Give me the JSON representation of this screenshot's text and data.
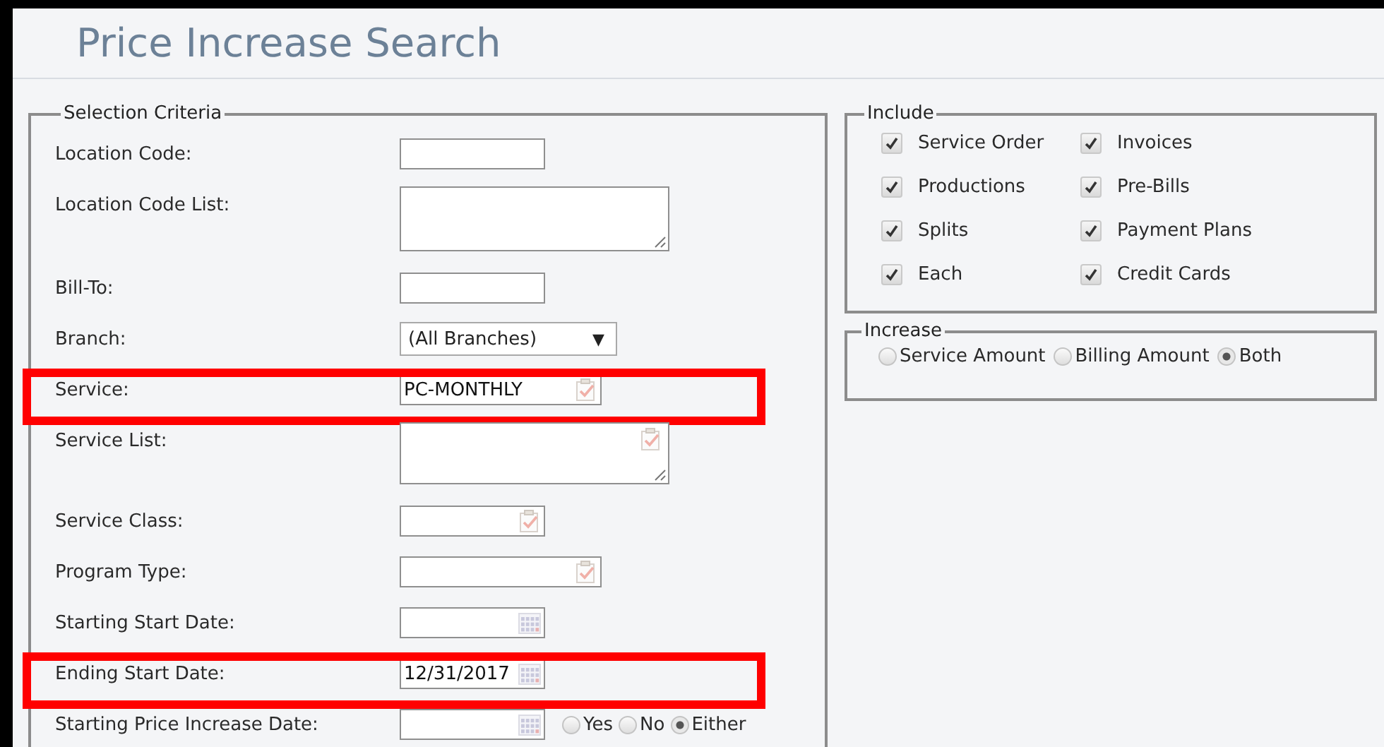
{
  "title": "Price Increase Search",
  "selection_criteria": {
    "legend": "Selection Criteria",
    "rows": [
      {
        "kind": "text",
        "label": "Location Code:",
        "highlighted": false
      },
      {
        "kind": "textarea",
        "label": "Location Code List:",
        "highlighted": false
      },
      {
        "kind": "text",
        "label": "Bill-To:",
        "highlighted": false
      },
      {
        "kind": "select",
        "label": "Branch:",
        "value": "(All Branches)",
        "caret": "▼",
        "highlighted": false
      },
      {
        "kind": "lookup",
        "label": "Service:",
        "value": "PC-MONTHLY",
        "highlighted": true
      },
      {
        "kind": "lookup_list",
        "label": "Service List:",
        "highlighted": false
      },
      {
        "kind": "lookup_short",
        "label": "Service Class:",
        "highlighted": false
      },
      {
        "kind": "lookup",
        "label": "Program Type:",
        "highlighted": false
      },
      {
        "kind": "date",
        "label": "Starting Start Date:",
        "highlighted": false
      },
      {
        "kind": "date",
        "label": "Ending Start Date:",
        "value": "12/31/2017",
        "highlighted": true
      },
      {
        "kind": "date_radio",
        "label": "Starting Price Increase Date:",
        "highlighted": false,
        "options": [
          {
            "label": "Yes",
            "selected": false
          },
          {
            "label": "No",
            "selected": false
          },
          {
            "label": "Either",
            "selected": true
          }
        ]
      }
    ]
  },
  "include": {
    "legend": "Include",
    "items": [
      {
        "label": "Service Order",
        "checked": true
      },
      {
        "label": "Invoices",
        "checked": true
      },
      {
        "label": "Productions",
        "checked": true
      },
      {
        "label": "Pre-Bills",
        "checked": true
      },
      {
        "label": "Splits",
        "checked": true
      },
      {
        "label": "Payment Plans",
        "checked": true
      },
      {
        "label": "Each",
        "checked": true
      },
      {
        "label": "Credit Cards",
        "checked": true
      }
    ]
  },
  "increase": {
    "legend": "Increase",
    "options": [
      {
        "label": "Service Amount",
        "selected": false
      },
      {
        "label": "Billing Amount",
        "selected": false
      },
      {
        "label": "Both",
        "selected": true
      }
    ]
  }
}
